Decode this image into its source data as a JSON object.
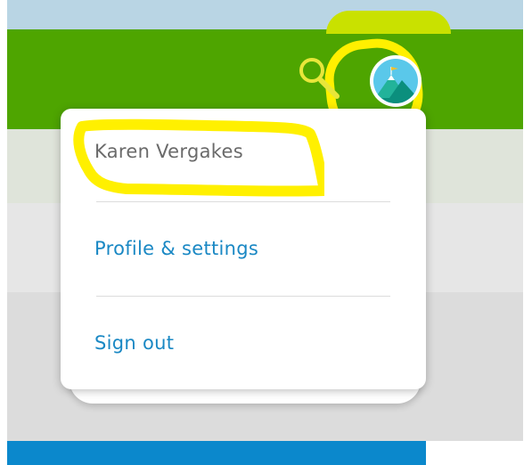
{
  "header": {
    "search_icon": "search-icon",
    "avatar_icon": "mountain-avatar-icon"
  },
  "account_menu": {
    "user_name": "Karen Vergakes",
    "items": [
      {
        "label": "Profile & settings"
      },
      {
        "label": "Sign out"
      }
    ]
  },
  "colors": {
    "header_green": "#4ea500",
    "link_blue": "#1a88c4",
    "highlight_yellow": "#fff000"
  }
}
